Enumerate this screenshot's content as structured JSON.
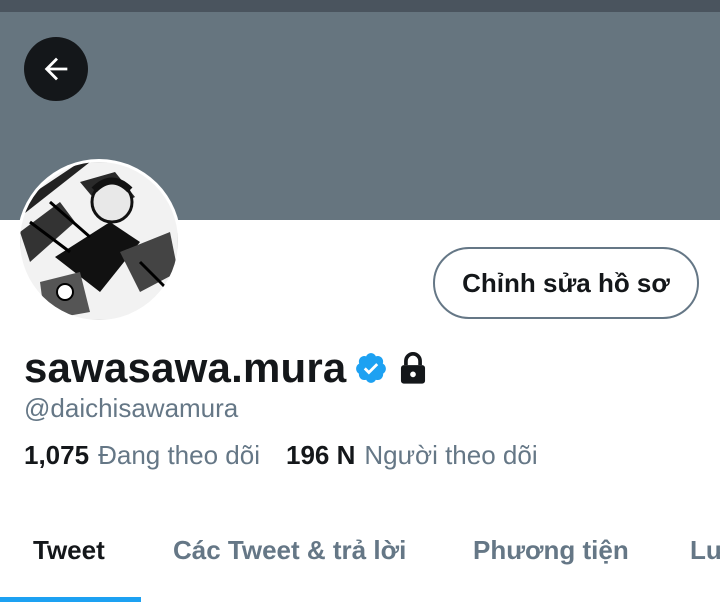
{
  "profile": {
    "display_name": "sawasawa.mura",
    "handle": "@daichisawamura",
    "verified": true,
    "protected": true
  },
  "actions": {
    "edit_profile_label": "Chỉnh sửa hồ sơ"
  },
  "stats": {
    "following_count": "1,075",
    "following_label": "Đang theo dõi",
    "followers_count": "196 N",
    "followers_label": "Người theo dõi"
  },
  "tabs": [
    {
      "label": "Tweet",
      "active": true
    },
    {
      "label": "Các Tweet & trả lời",
      "active": false
    },
    {
      "label": "Phương tiện",
      "active": false
    },
    {
      "label": "Lư",
      "active": false
    }
  ],
  "colors": {
    "banner": "#66757f",
    "accent": "#1da1f2",
    "text_primary": "#14171a",
    "text_secondary": "#657786"
  },
  "icons": {
    "back": "arrow-left-icon",
    "verified": "verified-badge-icon",
    "protected": "lock-icon"
  }
}
